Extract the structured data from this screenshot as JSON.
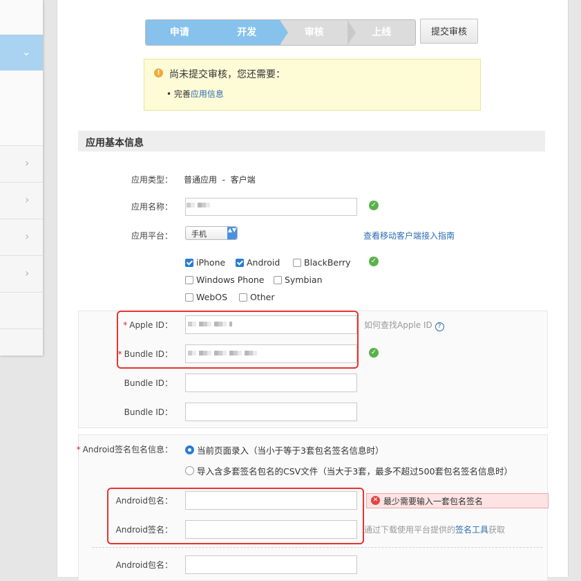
{
  "steps": [
    "申请",
    "开发",
    "审核",
    "上线"
  ],
  "submit_label": "提交审核",
  "notice": {
    "message": "尚未提交审核，您还需要：",
    "bullet": "•",
    "item_prefix": "完善",
    "item_link": "应用信息"
  },
  "section_title": "应用基本信息",
  "app_type": {
    "label": "应用类型：",
    "value": "普通应用  -  客户端"
  },
  "app_name": {
    "label": "应用名称：",
    "value": ""
  },
  "app_platform": {
    "label": "应用平台：",
    "select_value": "手机",
    "guide_link": "查看移动客户端接入指南"
  },
  "platforms": [
    {
      "name": "iPhone",
      "checked": true
    },
    {
      "name": "Android",
      "checked": true
    },
    {
      "name": "BlackBerry",
      "checked": false
    },
    {
      "name": "Windows Phone",
      "checked": false
    },
    {
      "name": "Symbian",
      "checked": false
    },
    {
      "name": "WebOS",
      "checked": false
    },
    {
      "name": "Other",
      "checked": false
    }
  ],
  "ios": {
    "apple_id_label": "Apple ID：",
    "bundle_id_label": "Bundle ID：",
    "apple_help": "如何查找Apple ID",
    "help_icon": "?"
  },
  "android": {
    "sig_label": "Android签名包名信息：",
    "radio1": "当前页面录入（当小于等于3套包名签名信息时）",
    "radio2": "导入含多套签名包名的CSV文件（当大于3套，最多不超过500套包名签名信息时）",
    "pkg_label": "Android包名：",
    "sign_label": "Android签名：",
    "error": "最少需要输入一套包名签名",
    "hint_prefix": "通过下载使用平台提供的",
    "hint_link": "签名工具",
    "hint_suffix": "获取"
  },
  "required_mark": "*",
  "icons": {
    "warning": "!",
    "ok": "✓",
    "error": "✕",
    "chevron_down": "⌄",
    "chevron_right": "›",
    "select_arrows": "▲▼"
  },
  "colors": {
    "step_done": "#86c2ec",
    "step_todo": "#dcdcdc",
    "link": "#2a6cb3",
    "ok": "#59b24a",
    "error": "#e04444",
    "highlight": "#e8322f"
  }
}
